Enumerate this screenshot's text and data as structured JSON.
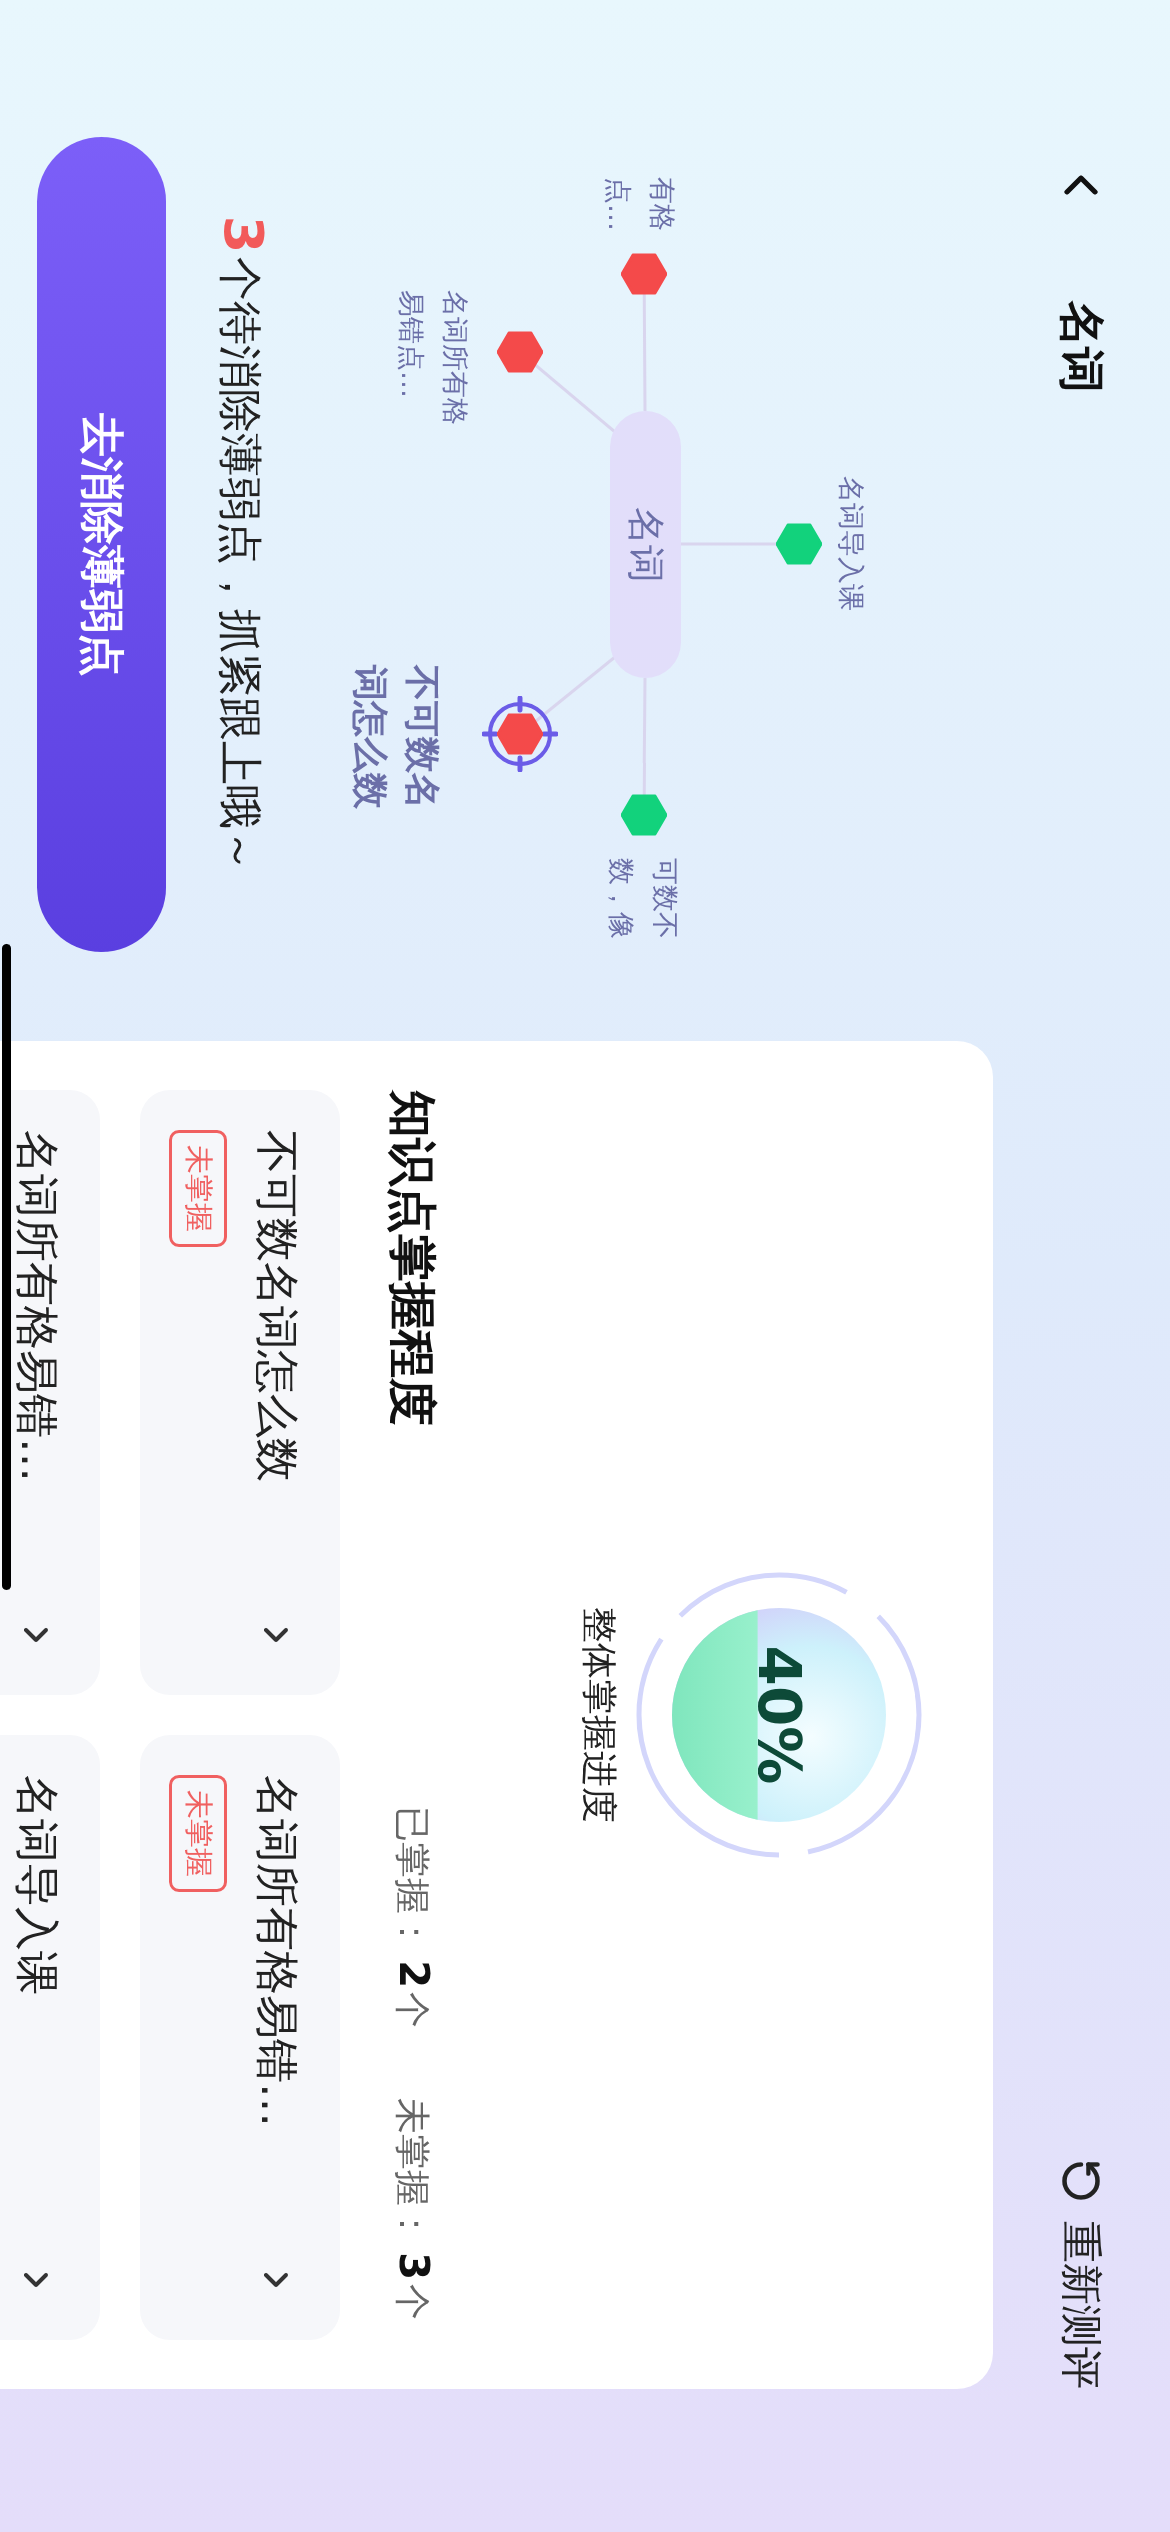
{
  "header": {
    "title": "名词",
    "action": "重新测评"
  },
  "mind_map": {
    "center": "名词",
    "nodes": [
      {
        "label_lines": [
          "有格",
          "点…"
        ],
        "mastered": false,
        "selected": false
      },
      {
        "label_lines": [
          "名词所有格",
          "易错点…"
        ],
        "mastered": false,
        "selected": false
      },
      {
        "label_lines": [
          "名词导入课"
        ],
        "mastered": true,
        "selected": false
      },
      {
        "label_lines": [
          "不可数名",
          "词怎么数"
        ],
        "mastered": false,
        "selected": true
      },
      {
        "label_lines": [
          "可数不",
          "数，像"
        ],
        "mastered": true,
        "selected": false
      }
    ]
  },
  "hint": {
    "count": "3",
    "text": "个待消除薄弱点，抓紧跟上哦～"
  },
  "primary_button": "去消除薄弱点",
  "mastery_card": {
    "gauge": {
      "value": "40%",
      "level": 0.4,
      "caption": "整体掌握进度"
    },
    "title": "知识点掌握程度",
    "stats": [
      {
        "label": "已掌握：",
        "count": "2",
        "unit": "个"
      },
      {
        "label": "未掌握：",
        "count": "3",
        "unit": "个"
      }
    ],
    "items": [
      {
        "title": "不可数名词怎么数",
        "tag": "未掌握"
      },
      {
        "title": "名词所有格易错…",
        "tag": "未掌握"
      },
      {
        "title": "名词所有格易错…"
      },
      {
        "title": "名词导入课"
      }
    ]
  }
}
